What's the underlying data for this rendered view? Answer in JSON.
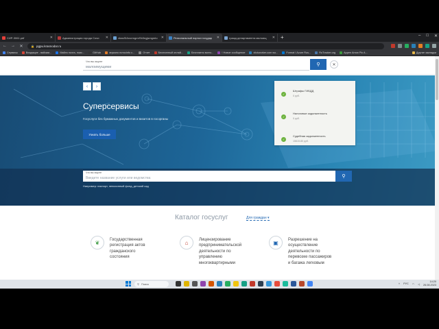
{
  "browser": {
    "tabs": [
      {
        "title": "СИР-3061.pdf",
        "color": "#e5403a"
      },
      {
        "title": "Администрация города Сочи",
        "color": "#b53a3a"
      },
      {
        "title": "vbasSIAnormgmrSb3ngjsmgmto",
        "color": "#6a9fd0"
      },
      {
        "title": "Региональный портал государ",
        "color": "#3b82c4",
        "active": true
      },
      {
        "title": "гражд департамента малоищ",
        "color": "#7aa3cf"
      }
    ],
    "new_tab": "+",
    "url": "pgpu.krasnodar.ru",
    "bookmarks": [
      {
        "label": "Сервисы",
        "color": "#4285f4"
      },
      {
        "label": "Входящие - вайоми...",
        "color": "#d44638"
      },
      {
        "label": "Майлз почта, поис...",
        "color": "#1a73e8"
      },
      {
        "label": "GitHub",
        "color": "#333333"
      },
      {
        "label": "зеркало нотосinfo с...",
        "color": "#e27d2a"
      },
      {
        "label": "Отчет",
        "color": "#888888"
      },
      {
        "label": "Бесплатный онлай...",
        "color": "#c0392b"
      },
      {
        "label": "Бесплатно всего...",
        "color": "#16a085"
      },
      {
        "label": "! Новое сообщение",
        "color": "#8e44ad"
      },
      {
        "label": "clickworker.com wo...",
        "color": "#2980b9"
      },
      {
        "label": "Format I Azure Rus...",
        "color": "#0078d4"
      },
      {
        "label": "RuTracker.org",
        "color": "#4a76a8"
      },
      {
        "label": "Appen Arrow Pic A...",
        "color": "#3c9d3c"
      }
    ],
    "bookmarks_right": "Другие закладки"
  },
  "page": {
    "top_search": {
      "label": "Что вы ищите",
      "value": "малоимущими"
    },
    "hero": {
      "title": "Суперсервисы",
      "subtitle": "Госуслуги без бумажных документов и визитов в госорганы",
      "button": "Узнать больше",
      "prev": "‹",
      "next": "›"
    },
    "services": [
      {
        "title": "Штрафы ГИБДД",
        "sub": "0 руб."
      },
      {
        "title": "Налоговые задолженность",
        "sub": "0 руб."
      },
      {
        "title": "Судебная задолженность",
        "sub": "15615.80 руб."
      }
    ],
    "mid_search": {
      "label": "Что вы ищите",
      "placeholder": "Введите название услуги или ведомства",
      "example": "Например: паспорт, пенсионный фонд, детский сад"
    },
    "catalog": {
      "title": "Каталог госуслуг",
      "filter": "Для граждан",
      "items": [
        {
          "icon": "leaf-icon",
          "color": "#3f9b45",
          "text": "Государственная\nрегистрация актов\nгражданского\nсостояния"
        },
        {
          "icon": "house-icon",
          "color": "#c0392b",
          "text": "Лицензирование\nпредпринимательской\nдеятельности по\nуправлению\nмногоквартирными"
        },
        {
          "icon": "bus-icon",
          "color": "#2167b2",
          "text": "Разрешение на\nосуществление\nдеятельности по\nперевозке пассажиров\nи багажа легковым"
        }
      ]
    }
  },
  "taskbar": {
    "search": "Поиск",
    "lang": "РУС",
    "time": "14:20",
    "date": "26.08.2023"
  }
}
